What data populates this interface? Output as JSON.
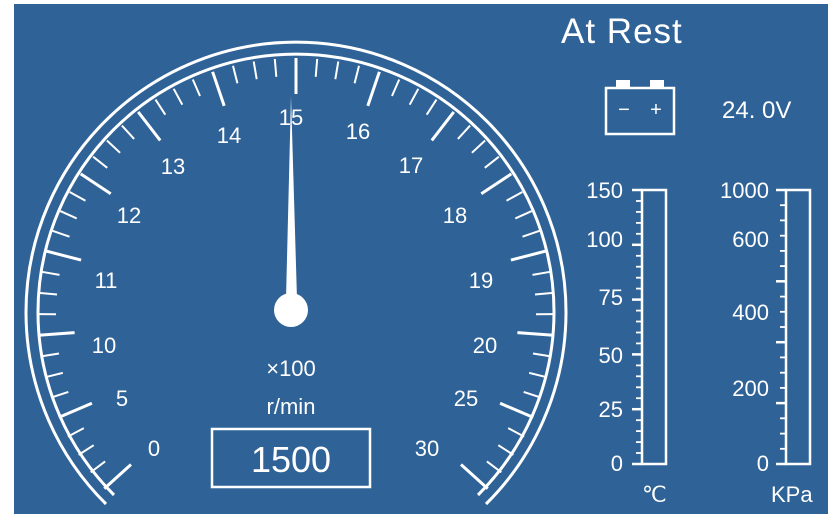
{
  "status": {
    "text": "At Rest"
  },
  "battery": {
    "voltage": "24. 0V",
    "minus": "−",
    "plus": "+"
  },
  "tachometer": {
    "tick_labels": [
      "0",
      "5",
      "10",
      "11",
      "12",
      "13",
      "14",
      "15",
      "16",
      "17",
      "18",
      "19",
      "20",
      "25",
      "30"
    ],
    "multiplier_label": "×100",
    "unit_label": "r/min",
    "needle_value_label": "15",
    "readout": "1500"
  },
  "temperature_gauge": {
    "tick_labels": [
      "0",
      "25",
      "50",
      "75",
      "100",
      "150"
    ],
    "unit": "℃"
  },
  "pressure_gauge": {
    "tick_labels": [
      "0",
      "200",
      "400",
      "600",
      "1000"
    ],
    "unit": "KPa"
  },
  "colors": {
    "background": "#2f6296",
    "foreground": "#ffffff"
  }
}
